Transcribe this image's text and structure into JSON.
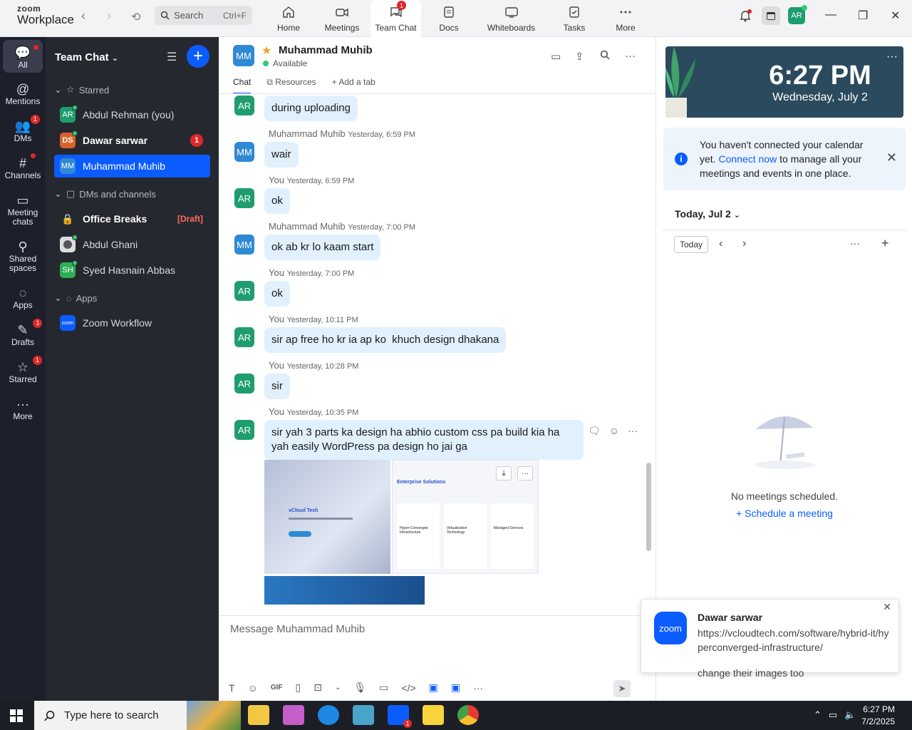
{
  "app": {
    "logo_top": "zoom",
    "logo_bottom": "Workplace"
  },
  "search": {
    "label": "Search",
    "shortcut": "Ctrl+F"
  },
  "tabs": [
    {
      "label": "Home",
      "icon": "home-icon"
    },
    {
      "label": "Meetings",
      "icon": "video-icon"
    },
    {
      "label": "Team Chat",
      "icon": "chat-icon",
      "badge": "1"
    },
    {
      "label": "Docs",
      "icon": "doc-icon"
    },
    {
      "label": "Whiteboards",
      "icon": "whiteboard-icon"
    },
    {
      "label": "Tasks",
      "icon": "tasks-icon"
    },
    {
      "label": "More",
      "icon": "more-icon"
    }
  ],
  "user_avatar": "AR",
  "rail": [
    {
      "label": "All",
      "icon": "chat-icon"
    },
    {
      "label": "Mentions",
      "icon": "at-icon"
    },
    {
      "label": "DMs",
      "icon": "people-icon",
      "badge": "1"
    },
    {
      "label": "Channels",
      "icon": "hash-icon"
    },
    {
      "label": "Meeting chats",
      "icon": "calendar-icon"
    },
    {
      "label": "Shared spaces",
      "icon": "share-icon"
    },
    {
      "label": "Apps",
      "icon": "apps-icon"
    },
    {
      "label": "Drafts",
      "icon": "draft-icon",
      "badge": "1"
    },
    {
      "label": "Starred",
      "icon": "star-icon",
      "badge": "1"
    },
    {
      "label": "More",
      "icon": "more-icon"
    }
  ],
  "sidebar": {
    "title": "Team Chat",
    "sections": {
      "starred": "Starred",
      "dms": "DMs and channels",
      "apps": "Apps"
    },
    "starred_items": [
      {
        "initials": "AR",
        "name": "Abdul Rehman (you)"
      },
      {
        "initials": "DS",
        "name": "Dawar sarwar",
        "badge": "1"
      },
      {
        "initials": "MM",
        "name": "Muhammad Muhib"
      }
    ],
    "dm_items": [
      {
        "name": "Office Breaks",
        "tag": "[Draft]"
      },
      {
        "name": "Abdul Ghani"
      },
      {
        "initials": "SH",
        "name": "Syed Hasnain Abbas"
      }
    ],
    "app_items": [
      {
        "initials": "zoom",
        "name": "Zoom Workflow"
      }
    ]
  },
  "chat": {
    "avatar": "MM",
    "name": "Muhammad Muhib",
    "status": "Available",
    "tabs": [
      "Chat",
      "Resources",
      "Add a tab"
    ],
    "messages": [
      {
        "avatar": "AR",
        "text": "during uploading"
      },
      {
        "avatar": "MM",
        "sender": "Muhammad Muhib",
        "time": "Yesterday, 6:59 PM",
        "text": "wair"
      },
      {
        "avatar": "AR",
        "sender": "You",
        "time": "Yesterday, 6:59 PM",
        "text": "ok"
      },
      {
        "avatar": "MM",
        "sender": "Muhammad Muhib",
        "time": "Yesterday, 7:00 PM",
        "text": "ok ab kr lo kaam start"
      },
      {
        "avatar": "AR",
        "sender": "You",
        "time": "Yesterday, 7:00 PM",
        "text": "ok"
      },
      {
        "avatar": "AR",
        "sender": "You",
        "time": "Yesterday, 10:11 PM",
        "text": "sir ap free ho kr ia ap ko  khuch design dhakana"
      },
      {
        "avatar": "AR",
        "sender": "You",
        "time": "Yesterday, 10:28 PM",
        "text": "sir"
      },
      {
        "avatar": "AR",
        "sender": "You",
        "time": "Yesterday, 10:35 PM",
        "text": "sir yah 3 parts ka design ha abhio custom css pa build kia ha yah easily WordPress pa design ho jai ga"
      }
    ],
    "attachment_title": "Enterprise Solutions",
    "attachment_cols": [
      "Hyper-Converged Infrastructure",
      "Virtualization Technology",
      "Managed Services"
    ],
    "attachment_left": "vCloud Tech",
    "input_placeholder": "Message Muhammad Muhib"
  },
  "calendar": {
    "time": "6:27 PM",
    "date": "Wednesday, July 2",
    "notice_pre": "You haven't connected your calendar yet.",
    "notice_link": "Connect now",
    "notice_post": "to manage all your meetings and events in one place.",
    "today_label": "Today, Jul 2",
    "today_btn": "Today",
    "empty": "No meetings scheduled.",
    "schedule": "Schedule a meeting"
  },
  "toast": {
    "logo": "zoom",
    "sender": "Dawar sarwar",
    "link": "https://vcloudtech.com/software/hybrid-it/hyperconverged-infrastructure/",
    "text": "change their images too"
  },
  "taskbar": {
    "search": "Type here to search",
    "time": "6:27 PM",
    "date": "7/2/2025",
    "zoom_badge": "1"
  }
}
